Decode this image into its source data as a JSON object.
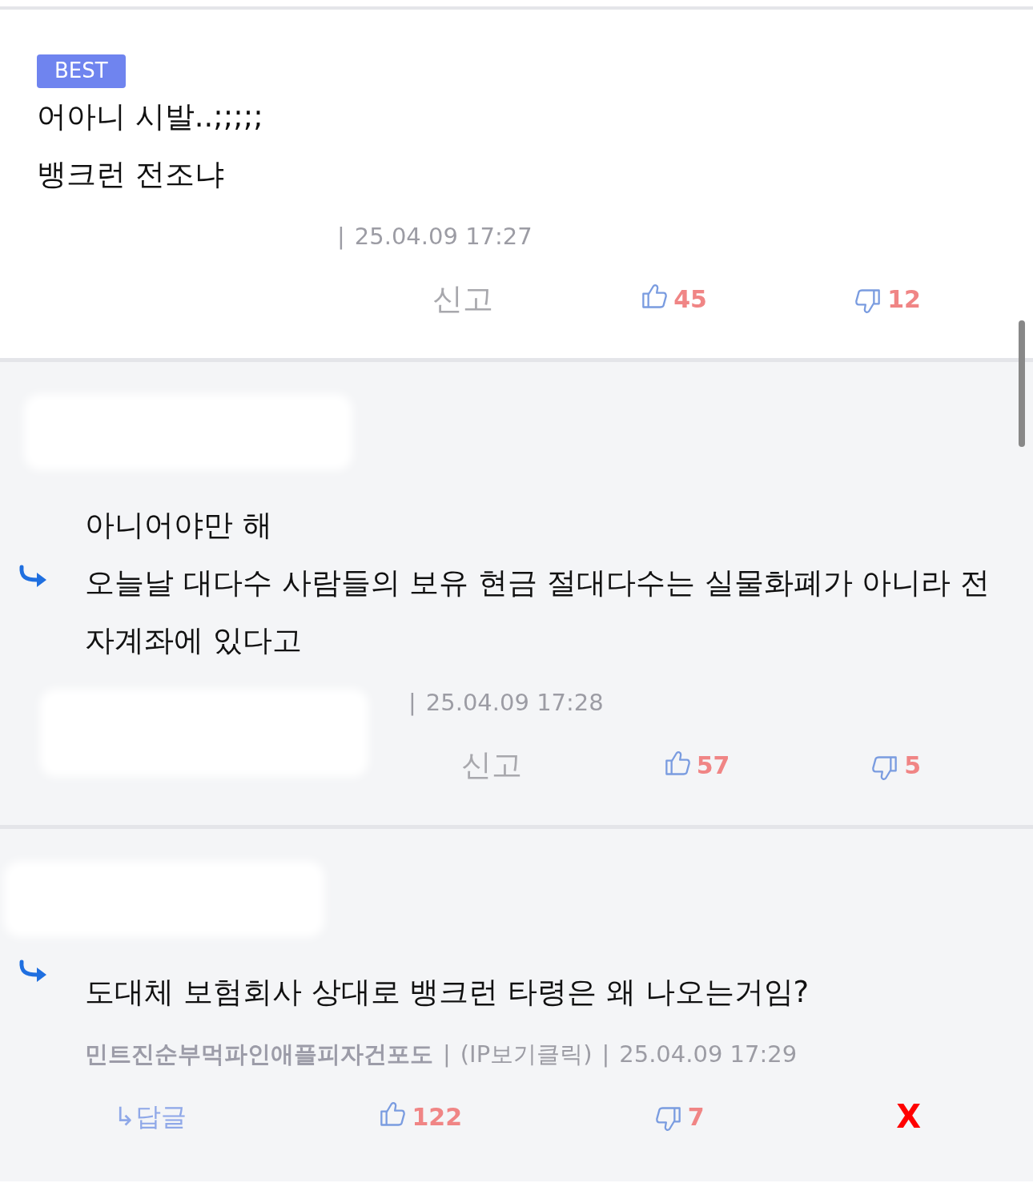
{
  "comments": [
    {
      "reply": false,
      "badge": "BEST",
      "redacted_header": false,
      "redacted_meta": true,
      "lines": [
        "어아니 시발..;;;;;",
        "뱅크런 전조냐"
      ],
      "meta": [
        {
          "kind": "sep",
          "text": "|"
        },
        {
          "kind": "date",
          "text": "25.04.09 17:27"
        }
      ],
      "actions": [
        {
          "kind": "report",
          "label": "신고"
        },
        {
          "kind": "up",
          "count": "45"
        },
        {
          "kind": "down",
          "count": "12"
        }
      ]
    },
    {
      "reply": true,
      "redacted_header": true,
      "redacted_meta": true,
      "lines": [
        "아니어야만 해",
        "오늘날 대다수 사람들의 보유 현금 절대다수는 실물화폐가 아니라 전자계좌에 있다고"
      ],
      "meta": [
        {
          "kind": "sep",
          "text": "|"
        },
        {
          "kind": "date",
          "text": "25.04.09 17:28"
        }
      ],
      "actions": [
        {
          "kind": "report",
          "label": "신고"
        },
        {
          "kind": "up",
          "count": "57"
        },
        {
          "kind": "down",
          "count": "5"
        }
      ]
    },
    {
      "reply": true,
      "redacted_header": true,
      "redacted_meta": false,
      "lines": [
        "도대체 보험회사 상대로 뱅크런 타령은 왜 나오는거임?"
      ],
      "meta": [
        {
          "kind": "author",
          "text": "민트진순부먹파인애플피자건포도"
        },
        {
          "kind": "sep",
          "text": "|"
        },
        {
          "kind": "ip",
          "text": "(IP보기클릭)"
        },
        {
          "kind": "sep",
          "text": "|"
        },
        {
          "kind": "date",
          "text": "25.04.09 17:29"
        }
      ],
      "actions": [
        {
          "kind": "reply",
          "label": "↳답글"
        },
        {
          "kind": "up",
          "count": "122"
        },
        {
          "kind": "down",
          "count": "7"
        },
        {
          "kind": "delete",
          "label": "X"
        }
      ]
    }
  ]
}
